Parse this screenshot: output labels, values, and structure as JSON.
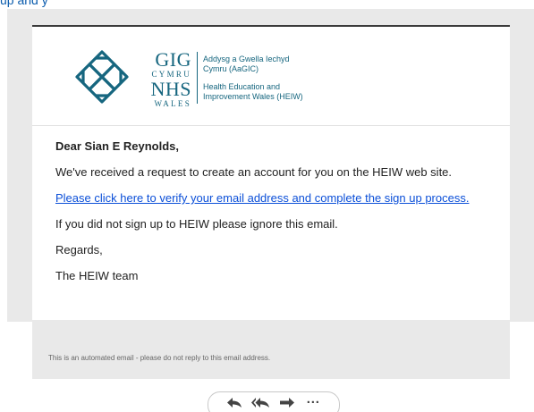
{
  "top_link_fragment": "up and y",
  "logo": {
    "gig": "GIG",
    "cymru": "CYMRU",
    "nhs": "NHS",
    "wales": "WALES",
    "welsh_line1": "Addysg a Gwella Iechyd",
    "welsh_line2": "Cymru (AaGIC)",
    "english_line1": "Health Education and",
    "english_line2": "Improvement Wales (HEIW)",
    "color": "#16667f"
  },
  "email": {
    "greeting": "Dear Sian E Reynolds,",
    "line1": "We've received a request to create an account for you on the HEIW web site.",
    "verify_link": "Please click here to verify your email address and complete the sign up process.",
    "line2": "If you did not sign up to HEIW please ignore this email.",
    "regards": "Regards,",
    "signature": "The HEIW team"
  },
  "footer": {
    "text": "This is an automated email - please do not reply to this email address."
  },
  "actions": {
    "reply_icon": "reply-icon",
    "reply_all_icon": "reply-all-icon",
    "forward_icon": "forward-icon",
    "more_icon": "more-icon",
    "more_label": "···"
  },
  "colors": {
    "link": "#0b4fd8",
    "frame_bg": "#e9e9e9",
    "brand": "#16667f"
  }
}
